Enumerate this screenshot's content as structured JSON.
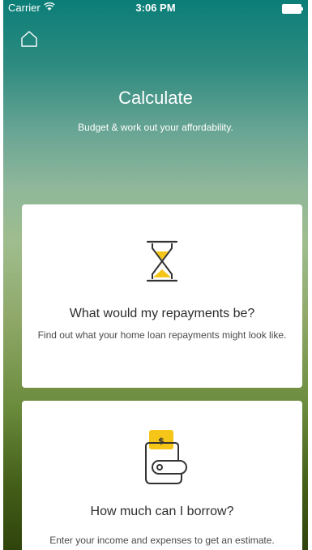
{
  "status_bar": {
    "carrier": "Carrier",
    "time": "3:06 PM"
  },
  "header": {
    "title": "Calculate",
    "subtitle": "Budget & work out your affordability."
  },
  "cards": [
    {
      "icon": "hourglass-icon",
      "title": "What would my repayments be?",
      "description": "Find out what your home loan repayments might look like."
    },
    {
      "icon": "wallet-icon",
      "title": "How much can I borrow?",
      "description": "Enter your income and expenses to get an estimate."
    }
  ],
  "colors": {
    "accent": "#f5c518",
    "gradient_top": "#0b7e78",
    "gradient_bottom": "#2f440c"
  }
}
